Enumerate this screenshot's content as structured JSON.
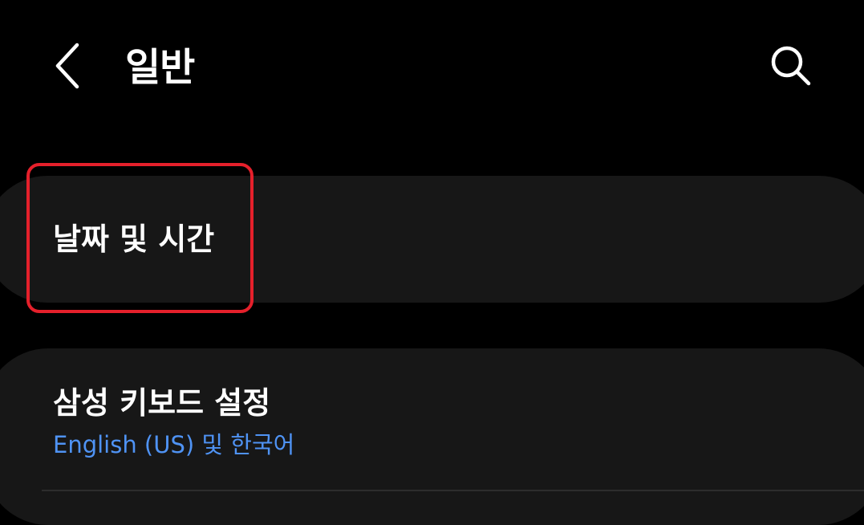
{
  "header": {
    "back_icon": "chevron-left-icon",
    "title": "일반",
    "search_icon": "search-icon"
  },
  "items": [
    {
      "title": "날짜 및 시간"
    },
    {
      "title": "삼성 키보드 설정",
      "subtitle": "English (US) 및 한국어"
    }
  ],
  "colors": {
    "background": "#000000",
    "card": "#171717",
    "text": "#ffffff",
    "subtitle_accent": "#4f93f4",
    "highlight": "#e5202b"
  }
}
